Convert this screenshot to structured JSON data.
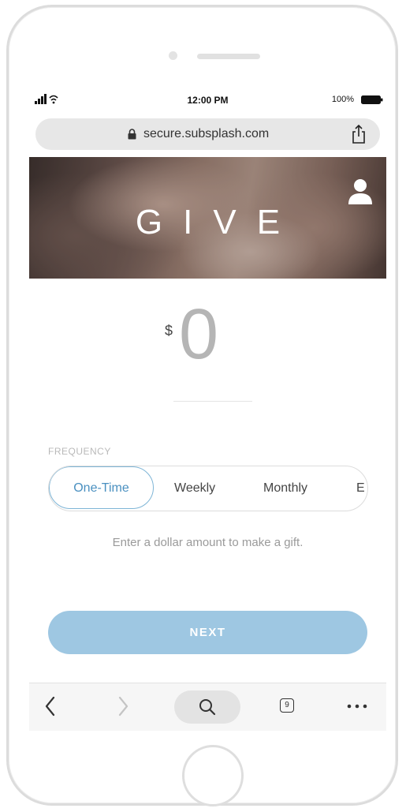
{
  "status_bar": {
    "time": "12:00 PM",
    "battery": "100%"
  },
  "browser": {
    "url": "secure.subsplash.com",
    "tab_count": "9"
  },
  "hero": {
    "title": "GIVE"
  },
  "amount": {
    "currency_symbol": "$",
    "value": "0"
  },
  "frequency": {
    "label": "FREQUENCY",
    "options": [
      "One-Time",
      "Weekly",
      "Monthly",
      "E"
    ],
    "selected": "One-Time"
  },
  "hint": "Enter a dollar amount to make a gift.",
  "next_button": "NEXT",
  "colors": {
    "accent": "#7eb5d6",
    "button": "#9ec7e2",
    "placeholder": "#b5b5b5"
  },
  "icons": [
    "signal-icon",
    "wifi-icon",
    "battery-icon",
    "lock-icon",
    "share-icon",
    "profile-icon",
    "back-icon",
    "forward-icon",
    "search-icon",
    "tabs-icon",
    "more-icon"
  ]
}
